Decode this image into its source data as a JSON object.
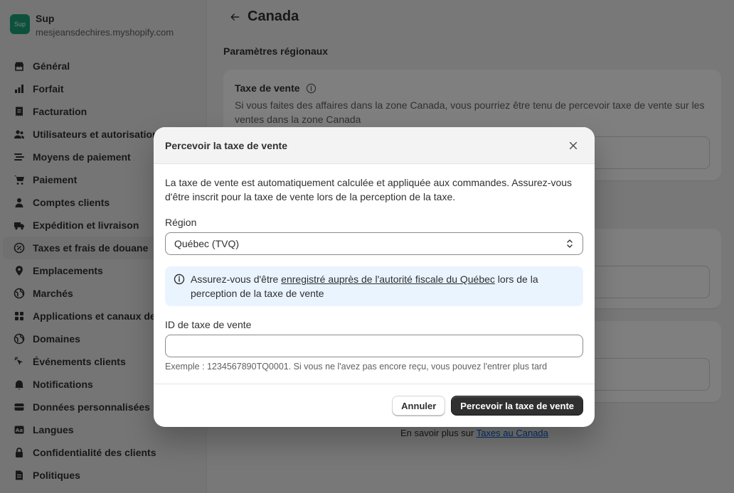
{
  "store": {
    "avatar": "Sup",
    "name": "Sup",
    "domain": "mesjeansdechires.myshopify.com"
  },
  "sidebar": {
    "items": [
      {
        "label": "Général",
        "icon": "store-icon"
      },
      {
        "label": "Forfait",
        "icon": "plan-icon"
      },
      {
        "label": "Facturation",
        "icon": "receipt-icon"
      },
      {
        "label": "Utilisateurs et autorisations",
        "icon": "users-icon"
      },
      {
        "label": "Moyens de paiement",
        "icon": "payment-icon"
      },
      {
        "label": "Paiement",
        "icon": "cart-icon"
      },
      {
        "label": "Comptes clients",
        "icon": "person-icon"
      },
      {
        "label": "Expédition et livraison",
        "icon": "truck-icon"
      },
      {
        "label": "Taxes et frais de douane",
        "icon": "tax-icon"
      },
      {
        "label": "Emplacements",
        "icon": "location-icon"
      },
      {
        "label": "Marchés",
        "icon": "globe-icon"
      },
      {
        "label": "Applications et canaux de vente",
        "icon": "apps-icon"
      },
      {
        "label": "Domaines",
        "icon": "globe-icon"
      },
      {
        "label": "Événements clients",
        "icon": "cursor-icon"
      },
      {
        "label": "Notifications",
        "icon": "bell-icon"
      },
      {
        "label": "Données personnalisées",
        "icon": "database-icon"
      },
      {
        "label": "Langues",
        "icon": "language-icon"
      },
      {
        "label": "Confidentialité des clients",
        "icon": "lock-icon"
      },
      {
        "label": "Politiques",
        "icon": "document-icon"
      }
    ]
  },
  "page": {
    "title": "Canada",
    "section_title": "Paramètres régionaux",
    "card1": {
      "heading": "Taxe de vente",
      "description": "Si vous faites des affaires dans la zone Canada, vous pourriez être tenu de percevoir taxe de vente sur les ventes dans la zone Canada"
    },
    "learn_more_prefix": "En savoir plus sur ",
    "learn_more_link": "Taxes au Canada"
  },
  "modal": {
    "title": "Percevoir la taxe de vente",
    "intro": "La taxe de vente est automatiquement calculée et appliquée aux commandes. Assurez-vous d'être inscrit pour la taxe de vente lors de la perception de la taxe.",
    "region_label": "Région",
    "region_value": "Québec (TVQ)",
    "banner_prefix": "Assurez-vous d'être ",
    "banner_link": "enregistré auprès de l'autorité fiscale du Québec",
    "banner_suffix": " lors de la perception de la taxe de vente",
    "tax_id_label": "ID de taxe de vente",
    "tax_id_value": "",
    "tax_id_help": "Exemple : 1234567890TQ0001. Si vous ne l'avez pas encore reçu, vous pouvez l'entrer plus tard",
    "cancel_label": "Annuler",
    "primary_label": "Percevoir la taxe de vente"
  },
  "colors": {
    "brand_avatar": "#1aa37a",
    "primary_button": "#303030",
    "info_banner": "#eaf4ff"
  }
}
